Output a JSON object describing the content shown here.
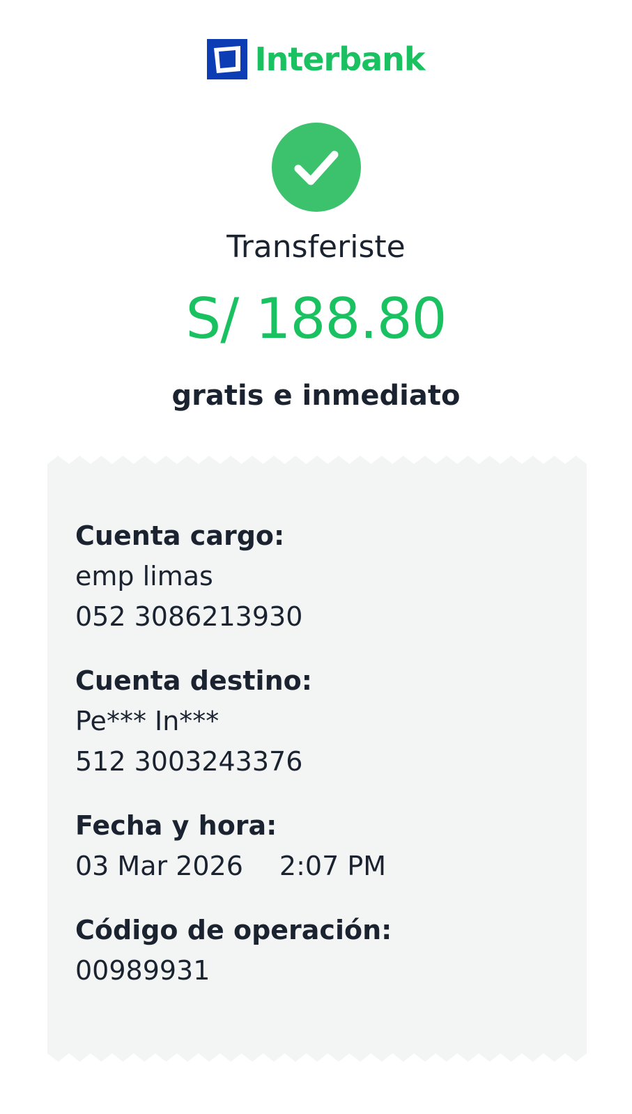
{
  "brand": {
    "name": "Interbank",
    "logo_icon": "interbank-logo-icon",
    "color": "#19c160",
    "mark_color": "#0d3db5"
  },
  "status": {
    "icon": "check-circle-icon",
    "color": "#3cc26c"
  },
  "transfer": {
    "title": "Transferiste",
    "amount": "S/ 188.80",
    "note": "gratis e inmediato"
  },
  "receipt": {
    "background": "#f3f5f5",
    "origin": {
      "label": "Cuenta cargo:",
      "name": "emp limas",
      "number": "052 3086213930"
    },
    "destination": {
      "label": "Cuenta destino:",
      "name": "Pe*** In***",
      "number": "512 3003243376"
    },
    "datetime": {
      "label": "Fecha y hora:",
      "date": "03 Mar 2026",
      "time": "2:07 PM"
    },
    "operation": {
      "label": "Código de operación:",
      "code": "00989931"
    }
  }
}
